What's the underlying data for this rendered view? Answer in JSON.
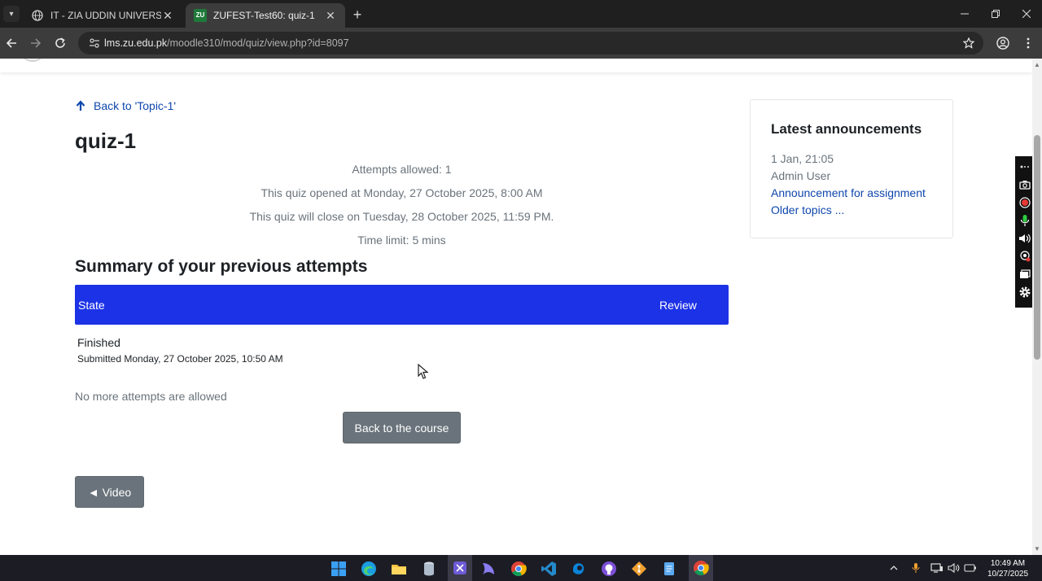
{
  "browser": {
    "tabs": [
      {
        "title": "IT - ZIA UDDIN UNIVERSITY",
        "active": false
      },
      {
        "title": "ZUFEST-Test60: quiz-1",
        "active": true
      }
    ],
    "favicon_text": "ZU",
    "url_host": "lms.zu.edu.pk",
    "url_path": "/moodle310/mod/quiz/view.php?id=8097"
  },
  "page": {
    "back_link": "Back to 'Topic-1'",
    "title": "quiz-1",
    "info": {
      "attempts_allowed": "Attempts allowed: 1",
      "opened": "This quiz opened at Monday, 27 October 2025, 8:00 AM",
      "close": "This quiz will close on Tuesday, 28 October 2025, 11:59 PM.",
      "time_limit": "Time limit: 5 mins"
    },
    "summary_heading": "Summary of your previous attempts",
    "table": {
      "headers": {
        "state": "State",
        "review": "Review"
      },
      "rows": [
        {
          "state": "Finished",
          "submitted": "Submitted Monday, 27 October 2025, 10:50 AM"
        }
      ]
    },
    "no_more_attempts": "No more attempts are allowed",
    "back_to_course": "Back to the course",
    "prev_activity": "◄ Video"
  },
  "announcements": {
    "title": "Latest announcements",
    "date": "1 Jan, 21:05",
    "author": "Admin User",
    "link": "Announcement for assignment",
    "older": "Older topics ..."
  },
  "taskbar": {
    "time": "10:49 AM",
    "date": "10/27/2025"
  },
  "colors": {
    "table_header": "#1c32e6",
    "link": "#0f47ad",
    "button": "#6a737b"
  }
}
